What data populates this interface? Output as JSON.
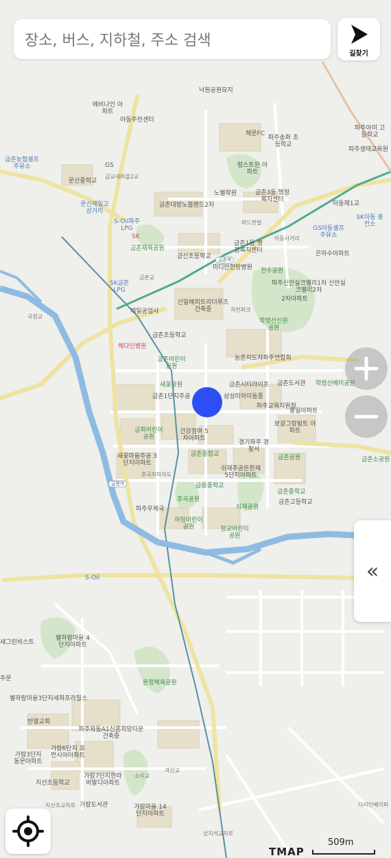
{
  "search": {
    "placeholder": "장소, 버스, 지하철, 주소 검색"
  },
  "route_button": {
    "label": "길찾기"
  },
  "zoom": {
    "in_symbol": "+",
    "out_symbol": "−"
  },
  "side_panel": {
    "symbol": "«"
  },
  "attribution": {
    "brand": "TMAP"
  },
  "scale": {
    "label": "509m"
  },
  "colors": {
    "location_dot": "#2e4ef5",
    "river": "#8eb9e0",
    "rail": "#4fa88f",
    "park": "#cfe3c4",
    "building": "#e4ddc7",
    "road_yellow": "#efe4a6"
  },
  "places": [
    "낙원공원묘지",
    "에비나인 아파트",
    "아동주민센터",
    "파주송화 초등학교",
    "해문FC",
    "파주아미 고등학교",
    "파주생태교육원",
    "금촌농협셀프 주유소",
    "GS",
    "문산중학교",
    "금교새마을2교",
    "럼스트윈 아파트",
    "노벨학원",
    "금촌3동 행정복지센터",
    "아동제1교",
    "SK아동 충전소",
    "문산제일고 삼거리",
    "S-Oil파주 LPG",
    "금촌대방노블랜드2차",
    "금촌재육공원",
    "GS아동셀프 주유소",
    "아동사거리",
    "마드한빌",
    "SK",
    "금신초등학교",
    "금촌1동 행정복지센터",
    "은하수아파트",
    "금촌역",
    "SK금촌 LPG",
    "금촌교",
    "천수공원",
    "미디안한방병원",
    "파주신안실크밸리1차 신안실크밸리2차",
    "2차아파트",
    "신일해피트리더루츠 건축중",
    "차전파크",
    "국청교",
    "제일공업사",
    "학령산신원 공원",
    "금촌초등학교",
    "헤다인병원",
    "금촌어린이 공원",
    "농촌지도자파주연합회",
    "새꽃공원",
    "금촌시티라이프",
    "금촌도서관",
    "학령산배미공원",
    "금촌1단지주공",
    "삼성미하이동종",
    "파주교육지원청",
    "통일아파트",
    "금화어린이 공원",
    "건강청며 5차아파트",
    "보광그랑빌트 아파트",
    "경기파주 경찰서",
    "금촌종합교",
    "새꽃마을주공 3단지아파트",
    "후곡지하차도",
    "쉬재주공돈한재 5단지아파트",
    "금촌공원",
    "금촌소공원",
    "금릉역",
    "금릉중학교",
    "금촌중학교",
    "금촌고등학교",
    "파주우체국",
    "후곡공원",
    "쉬재공원",
    "청교어린이 공원",
    "허밍어린이 공원",
    "S-Oil",
    "별하람마을 4단지아파트",
    "새그린비스트",
    "주문",
    "운정체육공원",
    "별하람마을3단지세화프라힐스",
    "반열교회",
    "파주와동A1신혼희망타운 건축중",
    "가람6단지 휴먼시아아파트",
    "가람3단지 동문아파트",
    "지선초등학교",
    "가람7단지한라 비발디아파트",
    "소리교",
    "과산교",
    "지선초교차로",
    "가람도서관",
    "가람마을 14단지아파트",
    "상지석교차로",
    "다리인베이파"
  ]
}
